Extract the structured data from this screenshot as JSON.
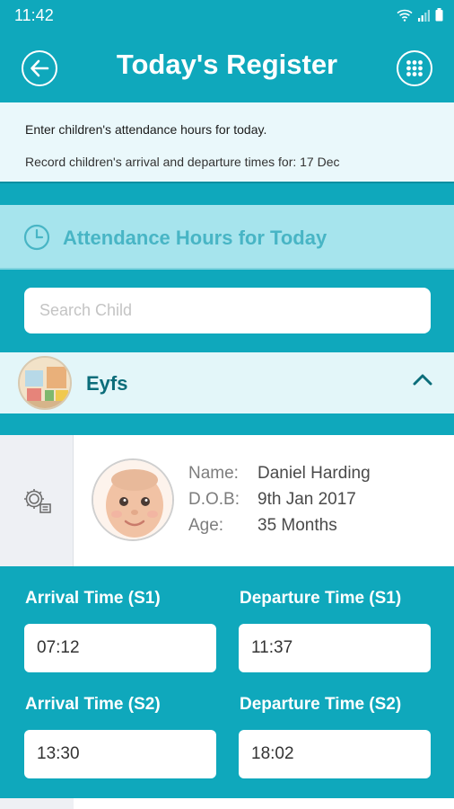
{
  "status_bar": {
    "time": "11:42",
    "icons": [
      "wifi-icon",
      "signal-icon",
      "battery-icon"
    ]
  },
  "app_bar": {
    "title": "Today's Register",
    "back_icon": "back-arrow-icon",
    "menu_icon": "grid-menu-icon"
  },
  "info": {
    "line1": "Enter children's attendance hours for today.",
    "line2": "Record children's arrival and departure times for: 17 Dec"
  },
  "section": {
    "title": "Attendance Hours for Today",
    "icon": "clock-icon"
  },
  "search": {
    "placeholder": "Search Child",
    "value": ""
  },
  "group": {
    "name": "Eyfs",
    "expanded": true
  },
  "child": {
    "name_label": "Name:",
    "name": "Daniel Harding",
    "dob_label": "D.O.B:",
    "dob": "9th Jan 2017",
    "age_label": "Age:",
    "age": "35 Months"
  },
  "times": {
    "arrival_s1_label": "Arrival Time (S1)",
    "arrival_s1": "07:12",
    "departure_s1_label": "Departure Time (S1)",
    "departure_s1": "11:37",
    "arrival_s2_label": "Arrival Time (S2)",
    "arrival_s2": "13:30",
    "departure_s2_label": "Departure Time (S2)",
    "departure_s2": "18:02"
  },
  "colors": {
    "primary": "#0fa8bc",
    "header_light": "#a6e4ed",
    "panel_light": "#eaf8fb",
    "group_bg": "#e3f6f9"
  }
}
